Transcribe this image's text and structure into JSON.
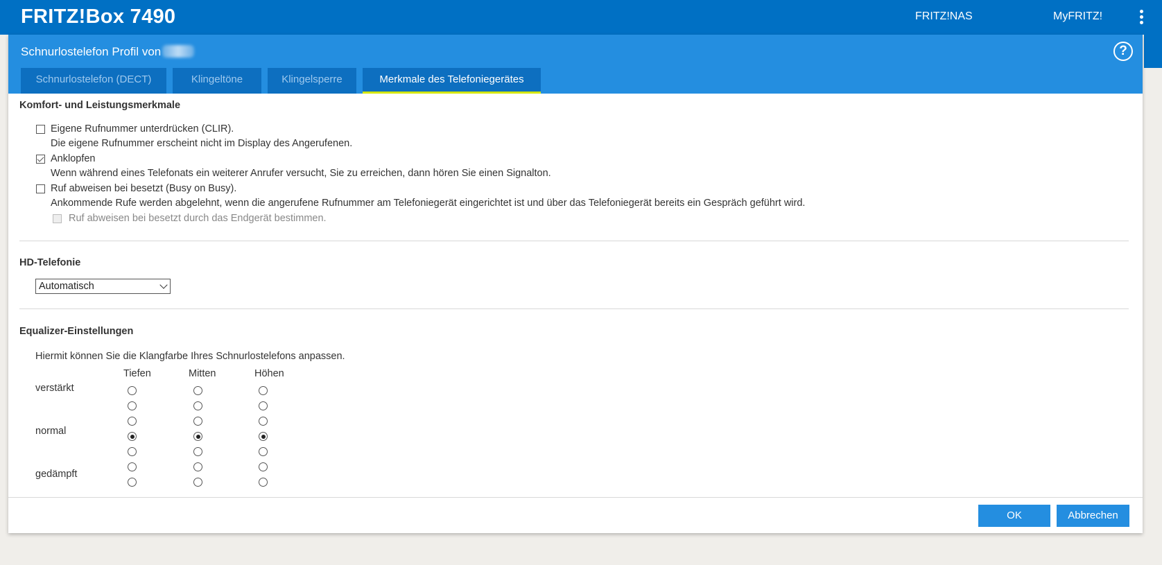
{
  "topbar": {
    "brand": "FRITZ!Box 7490",
    "links": [
      "FRITZ!NAS",
      "MyFRITZ!"
    ],
    "menu_icon": "kebab-menu-icon"
  },
  "panel": {
    "title": "Schnurlostelefon Profil von",
    "help_icon": "question-circle-icon",
    "tabs": [
      {
        "label": "Schnurlostelefon (DECT)"
      },
      {
        "label": "Klingeltöne"
      },
      {
        "label": "Klingelsperre"
      },
      {
        "label": "Merkmale des Telefoniegerätes"
      }
    ]
  },
  "comfort": {
    "title": "Komfort- und Leistungsmerkmale",
    "options": [
      {
        "label": "Eigene Rufnummer unterdrücken (CLIR).",
        "desc": "Die eigene Rufnummer erscheint nicht im Display des Angerufenen.",
        "checked": false
      },
      {
        "label": "Anklopfen",
        "desc": "Wenn während eines Telefonats ein weiterer Anrufer versucht, Sie zu erreichen, dann hören Sie einen Signalton.",
        "checked": true
      },
      {
        "label": "Ruf abweisen bei besetzt (Busy on Busy).",
        "desc": "Ankommende Rufe werden abgelehnt, wenn die angerufene Rufnummer am Telefoniegerät eingerichtet ist und über das Telefoniegerät bereits ein Gespräch geführt wird.",
        "checked": false
      }
    ],
    "sub_option": {
      "label": "Ruf abweisen bei besetzt durch das Endgerät bestimmen.",
      "checked": false,
      "disabled": true
    }
  },
  "hd": {
    "title": "HD-Telefonie",
    "selected": "Automatisch"
  },
  "equalizer": {
    "title": "Equalizer-Einstellungen",
    "intro": "Hiermit können Sie die Klangfarbe Ihres Schnurlostelefons anpassen.",
    "columns": [
      "Tiefen",
      "Mitten",
      "Höhen"
    ],
    "row_labels": [
      "verstärkt",
      "normal",
      "gedämpft"
    ],
    "levels": 7,
    "selected_level_index": [
      3,
      3,
      3
    ]
  },
  "footer": {
    "ok_label": "OK",
    "cancel_label": "Abbrechen"
  }
}
